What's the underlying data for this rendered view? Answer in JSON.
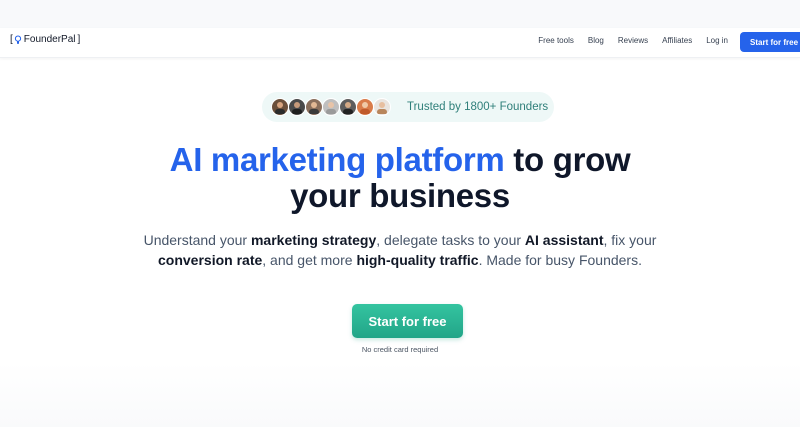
{
  "brand": {
    "bracket_open": "[",
    "name": "FounderPal",
    "bracket_close": "]",
    "icon": "lightbulb-icon"
  },
  "nav": {
    "links": [
      "Free tools",
      "Blog",
      "Reviews",
      "Affiliates",
      "Log in"
    ],
    "cta_label": "Start for free",
    "cta_color": "#2563eb"
  },
  "trust_badge": {
    "text": "Trusted by 1800+ Founders",
    "avatar_count": 7
  },
  "hero": {
    "headline_accent": "AI marketing platform",
    "headline_rest_line1": " to grow",
    "headline_line2": "your business",
    "accent_color": "#2563eb",
    "subtitle": {
      "s1": "Understand your ",
      "b1": "marketing strategy",
      "s2": ", delegate tasks to your ",
      "b2": "AI assistant",
      "s3": ", fix your",
      "b3": "conversion rate",
      "s4": ", and get more ",
      "b4": "high-quality traffic",
      "s5": ". Made for busy Founders."
    },
    "cta_label": "Start for free",
    "cta_color": "#2bb596",
    "note": "No credit card required"
  }
}
